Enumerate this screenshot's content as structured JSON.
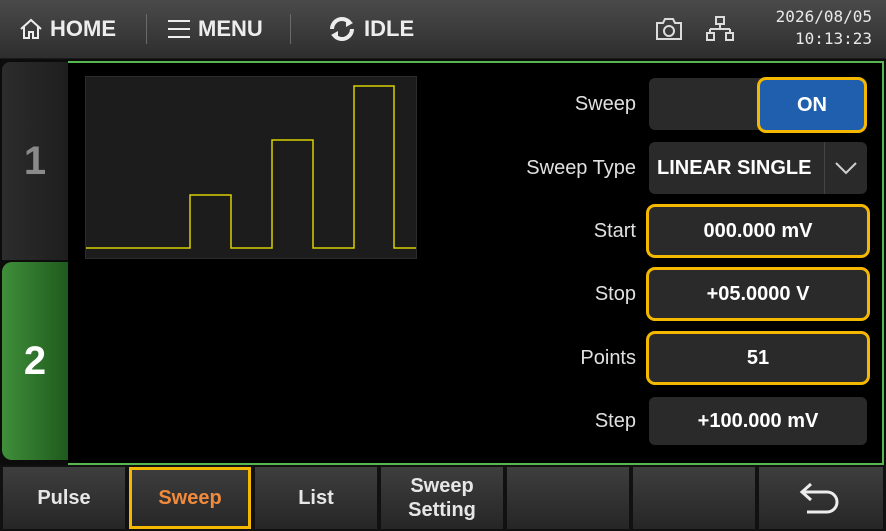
{
  "topbar": {
    "home_label": "HOME",
    "menu_label": "MENU",
    "status_label": "IDLE",
    "date": "2026/08/05",
    "time": "10:13:23",
    "icons": [
      "home-icon",
      "menu-icon",
      "refresh-icon",
      "camera-icon",
      "network-icon"
    ]
  },
  "tabs": [
    {
      "label": "1"
    },
    {
      "label": "2"
    }
  ],
  "sweep": {
    "sweep_label": "Sweep",
    "sweep_value": "ON",
    "type_label": "Sweep Type",
    "type_value": "LINEAR SINGLE",
    "start_label": "Start",
    "start_value": "000.000 mV",
    "stop_label": "Stop",
    "stop_value": "+05.0000 V",
    "points_label": "Points",
    "points_value": "51",
    "step_label": "Step",
    "step_value": "+100.000 mV"
  },
  "softkeys": {
    "pulse": "Pulse",
    "sweep": "Sweep",
    "list": "List",
    "sweep_setting_1": "Sweep",
    "sweep_setting_2": "Setting"
  },
  "colors": {
    "accent_green": "#57b64f",
    "highlight": "#f5b800",
    "on_blue": "#1f5fae",
    "active_softkey": "#f08a3c",
    "waveform": "#d8d000"
  }
}
